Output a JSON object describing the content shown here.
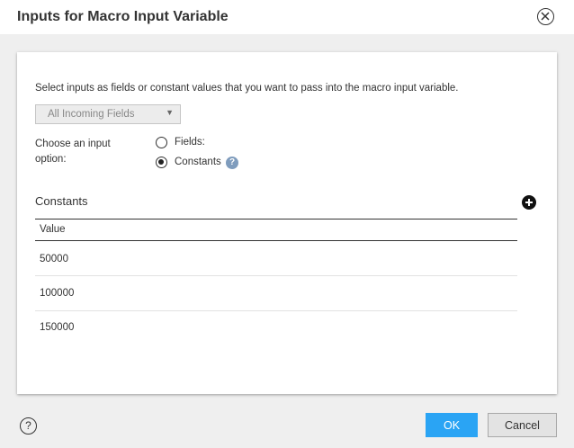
{
  "dialog": {
    "title": "Inputs for Macro Input Variable",
    "close_icon": "close-circle-icon"
  },
  "panel": {
    "instruction": "Select inputs as fields or constant values that you want to pass into the macro input variable.",
    "field_select": {
      "selected": "All Incoming Fields",
      "disabled": true
    },
    "input_option": {
      "label": "Choose an input option:",
      "options": [
        {
          "label": "Fields:",
          "checked": false
        },
        {
          "label": "Constants",
          "checked": true
        }
      ],
      "help_icon": "question-icon"
    },
    "constants": {
      "title": "Constants",
      "add_icon": "plus-circle-icon",
      "columns": [
        "Value"
      ],
      "rows": [
        "50000",
        "100000",
        "150000"
      ]
    }
  },
  "footer": {
    "help_icon": "help-circle-icon",
    "ok_label": "OK",
    "cancel_label": "Cancel"
  },
  "colors": {
    "primary_button": "#2aa4f4",
    "help_badge": "#7f9cbd",
    "background": "#efefef"
  }
}
